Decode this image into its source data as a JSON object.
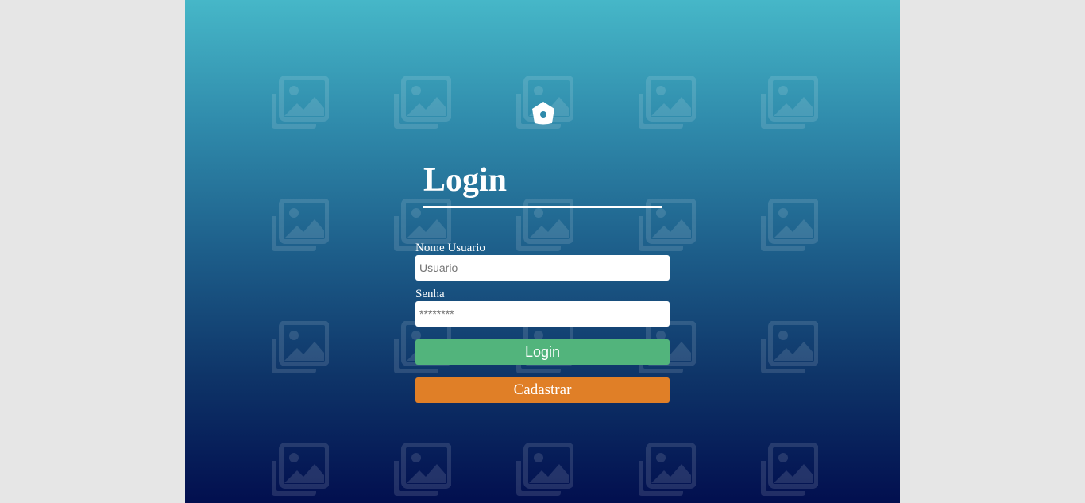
{
  "page": {
    "background_color": "#e6e6e6"
  },
  "panel": {
    "gradient_top": "#46b7c8",
    "gradient_bottom": "#020f4f",
    "pattern_icon": "image-placeholder-icon"
  },
  "header": {
    "icon": "home-icon"
  },
  "login": {
    "title": "Login",
    "username_label": "Nome Usuario",
    "username_placeholder": "Usuario",
    "username_value": "",
    "password_label": "Senha",
    "password_placeholder": "********",
    "password_value": "",
    "login_button": "Login",
    "login_button_color": "#52b47c",
    "register_button": "Cadastrar",
    "register_button_color": "#e07f27"
  }
}
